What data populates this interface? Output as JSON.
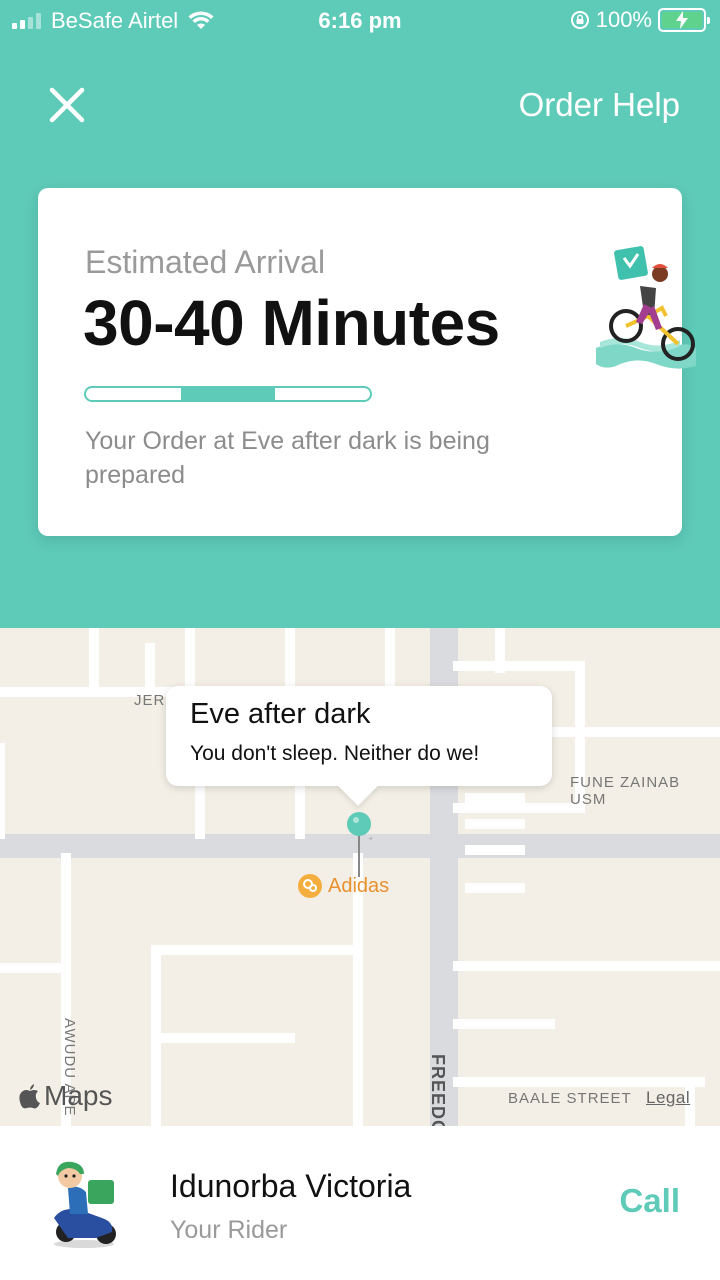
{
  "status_bar": {
    "carrier": "BeSafe Airtel",
    "time": "6:16 pm",
    "battery": "100%",
    "icons": [
      "signal-icon",
      "wifi-icon",
      "rotation-lock-icon",
      "battery-charging-icon"
    ]
  },
  "header": {
    "close_icon": "close-icon",
    "help_label": "Order Help"
  },
  "eta_card": {
    "label": "Estimated Arrival",
    "eta": "30-40 Minutes",
    "progress_stage": 2,
    "progress_stages": 3,
    "message": "Your Order at Eve after dark is being prepared",
    "illustration": "delivery-bicycle-icon"
  },
  "map": {
    "streets": {
      "top_left": "JER",
      "fune": "FUNE ZAINAB USM",
      "awudu": "AWUDU APE",
      "freedom": "FREEDO",
      "baale": "BAALE STREET"
    },
    "callout": {
      "name": "Eve after dark",
      "tagline": "You don't sleep. Neither do we!"
    },
    "poi": "Adidas",
    "brand": "Maps",
    "legal": "Legal"
  },
  "rider": {
    "name": "Idunorba Victoria",
    "role": "Your Rider",
    "call_label": "Call"
  },
  "colors": {
    "accent": "#5ecab8",
    "map_bg": "#f3efe6",
    "poi": "#e8912f"
  }
}
